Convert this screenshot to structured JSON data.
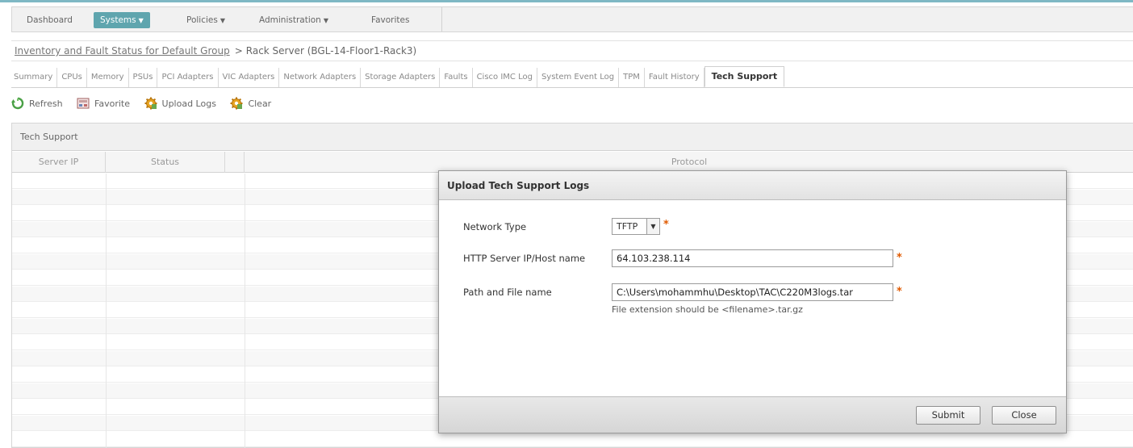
{
  "nav": {
    "items": [
      {
        "label": "Dashboard",
        "caret": ""
      },
      {
        "label": "Systems",
        "caret": "▼"
      },
      {
        "label": "Policies",
        "caret": "▼"
      },
      {
        "label": "Administration",
        "caret": "▼"
      },
      {
        "label": "Favorites",
        "caret": ""
      }
    ],
    "active_index": 1,
    "active_color": "#5fa5ae"
  },
  "breadcrumb": {
    "link": "Inventory and Fault Status for Default Group",
    "separator": ">",
    "current": "Rack Server (BGL-14-Floor1-Rack3)"
  },
  "tabs": [
    "Summary",
    "CPUs",
    "Memory",
    "PSUs",
    "PCI Adapters",
    "VIC Adapters",
    "Network Adapters",
    "Storage Adapters",
    "Faults",
    "Cisco IMC Log",
    "System Event Log",
    "TPM",
    "Fault History",
    "Tech Support"
  ],
  "active_tab": "Tech Support",
  "toolbar": {
    "refresh": "Refresh",
    "favorite": "Favorite",
    "upload_logs": "Upload Logs",
    "clear": "Clear"
  },
  "panel": {
    "title": "Tech Support",
    "columns": [
      "Server IP",
      "Status",
      "Protocol"
    ]
  },
  "modal": {
    "title": "Upload Tech Support Logs",
    "network_type_label": "Network Type",
    "network_type_value": "TFTP",
    "server_label": "HTTP Server IP/Host name",
    "server_value": "64.103.238.114",
    "path_label": "Path and File name",
    "path_value": "C:\\Users\\mohammhu\\Desktop\\TAC\\C220M3logs.tar",
    "path_hint": "File extension should be <filename>.tar.gz",
    "required_mark": "*",
    "submit": "Submit",
    "close": "Close"
  }
}
